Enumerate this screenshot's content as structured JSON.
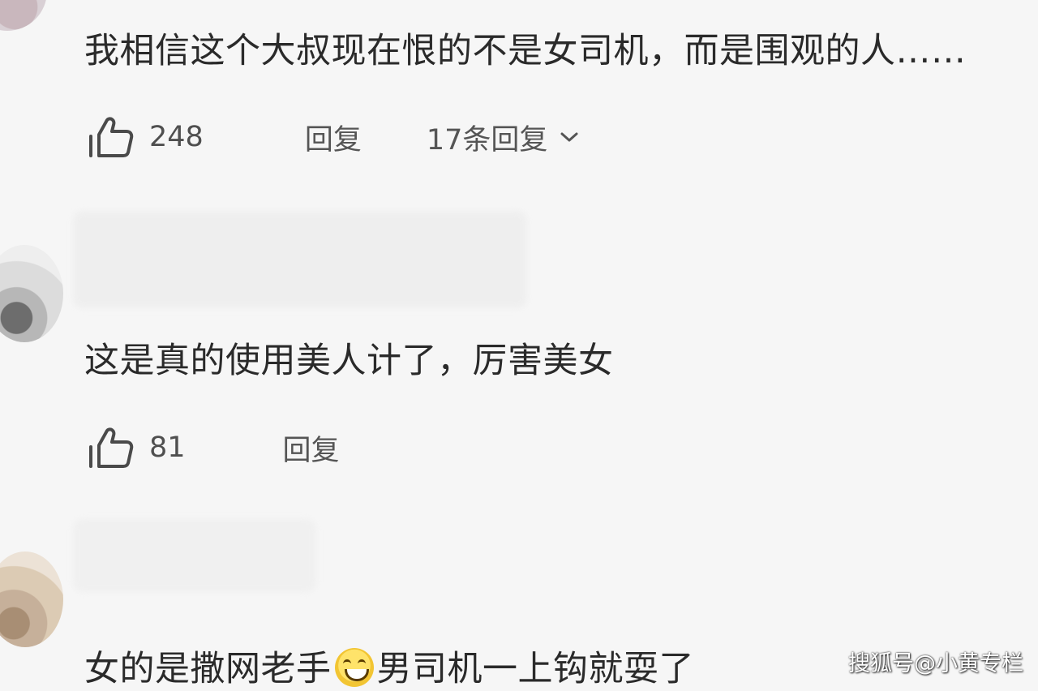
{
  "comments": [
    {
      "text": "我相信这个大叔现在恨的不是女司机，而是围观的人……",
      "like_count": "248",
      "reply_label": "回复",
      "replies_label": "17条回复"
    },
    {
      "text": "这是真的使用美人计了，厉害美女",
      "like_count": "81",
      "reply_label": "回复"
    },
    {
      "text_before_emoji": "女的是撒网老手",
      "text_after_emoji": "男司机一上钩就耍了",
      "emoji_icon": "grinning-face-icon"
    }
  ],
  "watermark": "搜狐号@小黄专栏"
}
